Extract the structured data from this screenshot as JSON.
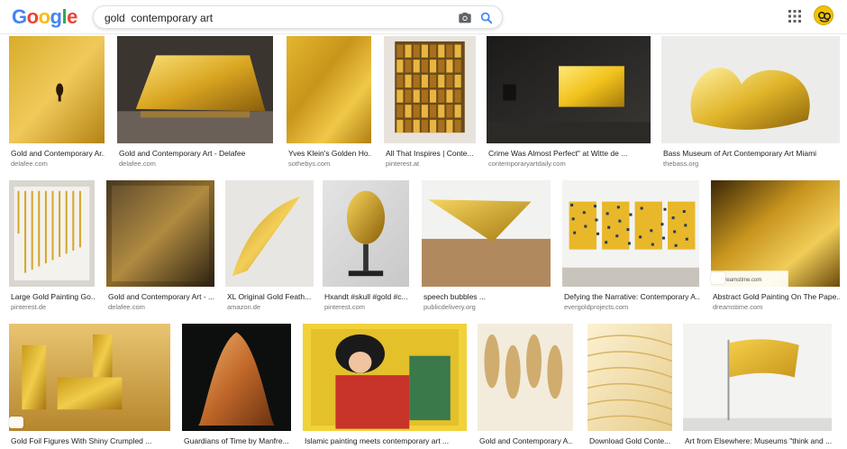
{
  "logo": [
    "G",
    "o",
    "o",
    "g",
    "l",
    "e"
  ],
  "logo_colors": [
    "#4285f4",
    "#ea4335",
    "#fbbc05",
    "#4285f4",
    "#34a853",
    "#ea4335"
  ],
  "search": {
    "query": "gold  contemporary art"
  },
  "icons": {
    "camera": "camera-icon",
    "search": "search-icon",
    "apps": "apps-grid-icon",
    "avatar": "account-avatar"
  },
  "rows": [
    {
      "items": [
        {
          "title": "Gold and Contemporary Ar...",
          "source": "delafee.com"
        },
        {
          "title": "Gold and Contemporary Art - Delafee",
          "source": "delafee.com"
        },
        {
          "title": "Yves Klein's Golden Ho...",
          "source": "sothebys.com"
        },
        {
          "title": "All That Inspires | Conte...",
          "source": "pinterest.at"
        },
        {
          "title": "Crime Was Almost Perfect\" at Witte de ...",
          "source": "contemporaryartdaily.com"
        },
        {
          "title": "Bass Museum of Art Contemporary Art Miami",
          "source": "thebass.org"
        }
      ]
    },
    {
      "items": [
        {
          "title": "Large Gold Painting Go...",
          "source": "pinterest.de"
        },
        {
          "title": "Gold and Contemporary Art - ...",
          "source": "delafee.com"
        },
        {
          "title": "XL Original Gold Feath...",
          "source": "amazon.de"
        },
        {
          "title": "Hxandt #skull #gold #c...",
          "source": "pinterest.com"
        },
        {
          "title": "speech bubbles ...",
          "source": "publicdelivery.org"
        },
        {
          "title": "Defying the Narrative: Contemporary A...",
          "source": "evergoldprojects.com"
        },
        {
          "title": "Abstract Gold Painting On The Pape...",
          "source": "dreamstime.com"
        }
      ]
    },
    {
      "items": [
        {
          "title": "Gold Foil Figures With Shiny Crumpled ...",
          "source": ""
        },
        {
          "title": "Guardians of Time by Manfre...",
          "source": ""
        },
        {
          "title": "Islamic painting meets contemporary art ...",
          "source": ""
        },
        {
          "title": "Gold and Contemporary A...",
          "source": ""
        },
        {
          "title": "Download Gold Conte...",
          "source": ""
        },
        {
          "title": "Art from Elsewhere: Museums \"think and ...",
          "source": ""
        }
      ]
    }
  ],
  "overlay_text": "dreamstime.com"
}
